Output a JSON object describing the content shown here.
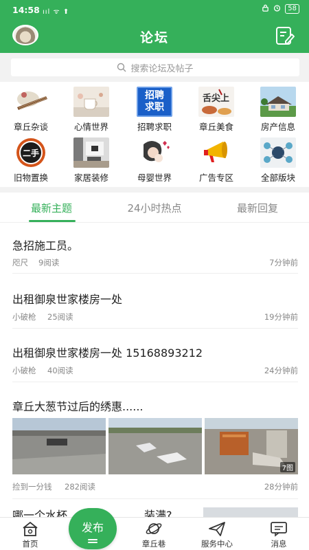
{
  "status_bar": {
    "time": "14:58",
    "signal": "ııl  ᯤ  ⬆",
    "battery": "58"
  },
  "header": {
    "title": "论坛"
  },
  "search": {
    "placeholder": "搜索论坛及帖子"
  },
  "categories": [
    {
      "label": "章丘杂谈",
      "icon": "zither-image"
    },
    {
      "label": "心情世界",
      "icon": "cup-image"
    },
    {
      "label": "招聘求职",
      "icon": "recruitment-image",
      "image_text": "招聘求职"
    },
    {
      "label": "章丘美食",
      "icon": "food-image",
      "image_text": "舌尖上"
    },
    {
      "label": "房产信息",
      "icon": "house-image"
    },
    {
      "label": "旧物置换",
      "icon": "secondhand-image",
      "image_text": "二手"
    },
    {
      "label": "家居装修",
      "icon": "interior-image"
    },
    {
      "label": "母婴世界",
      "icon": "mother-baby-image"
    },
    {
      "label": "广告专区",
      "icon": "megaphone-image"
    },
    {
      "label": "全部版块",
      "icon": "all-boards-image"
    }
  ],
  "tabs": [
    {
      "label": "最新主题",
      "active": true
    },
    {
      "label": "24小时热点",
      "active": false
    },
    {
      "label": "最新回复",
      "active": false
    }
  ],
  "posts": [
    {
      "title": "急招施工员。",
      "author": "咫尺",
      "reads": "9阅读",
      "time": "7分钟前"
    },
    {
      "title": "出租御泉世家楼房一处",
      "author": "小破枪",
      "reads": "25阅读",
      "time": "19分钟前"
    },
    {
      "title": "出租御泉世家楼房一处  15168893212",
      "author": "小破枪",
      "reads": "40阅读",
      "time": "24分钟前"
    },
    {
      "title": "章丘大葱节过后的绣惠......",
      "author": "捡到一分钱",
      "reads": "282阅读",
      "time": "28分钟前",
      "photo_count": "7图"
    },
    {
      "title": "哪一个水杯…………………装满?"
    }
  ],
  "bottom_nav": {
    "home": "首页",
    "publish": "发布",
    "lane": "章丘巷",
    "service": "服务中心",
    "messages": "消息"
  },
  "colors": {
    "brand": "#35b05a",
    "text": "#222222",
    "meta": "#888888"
  }
}
